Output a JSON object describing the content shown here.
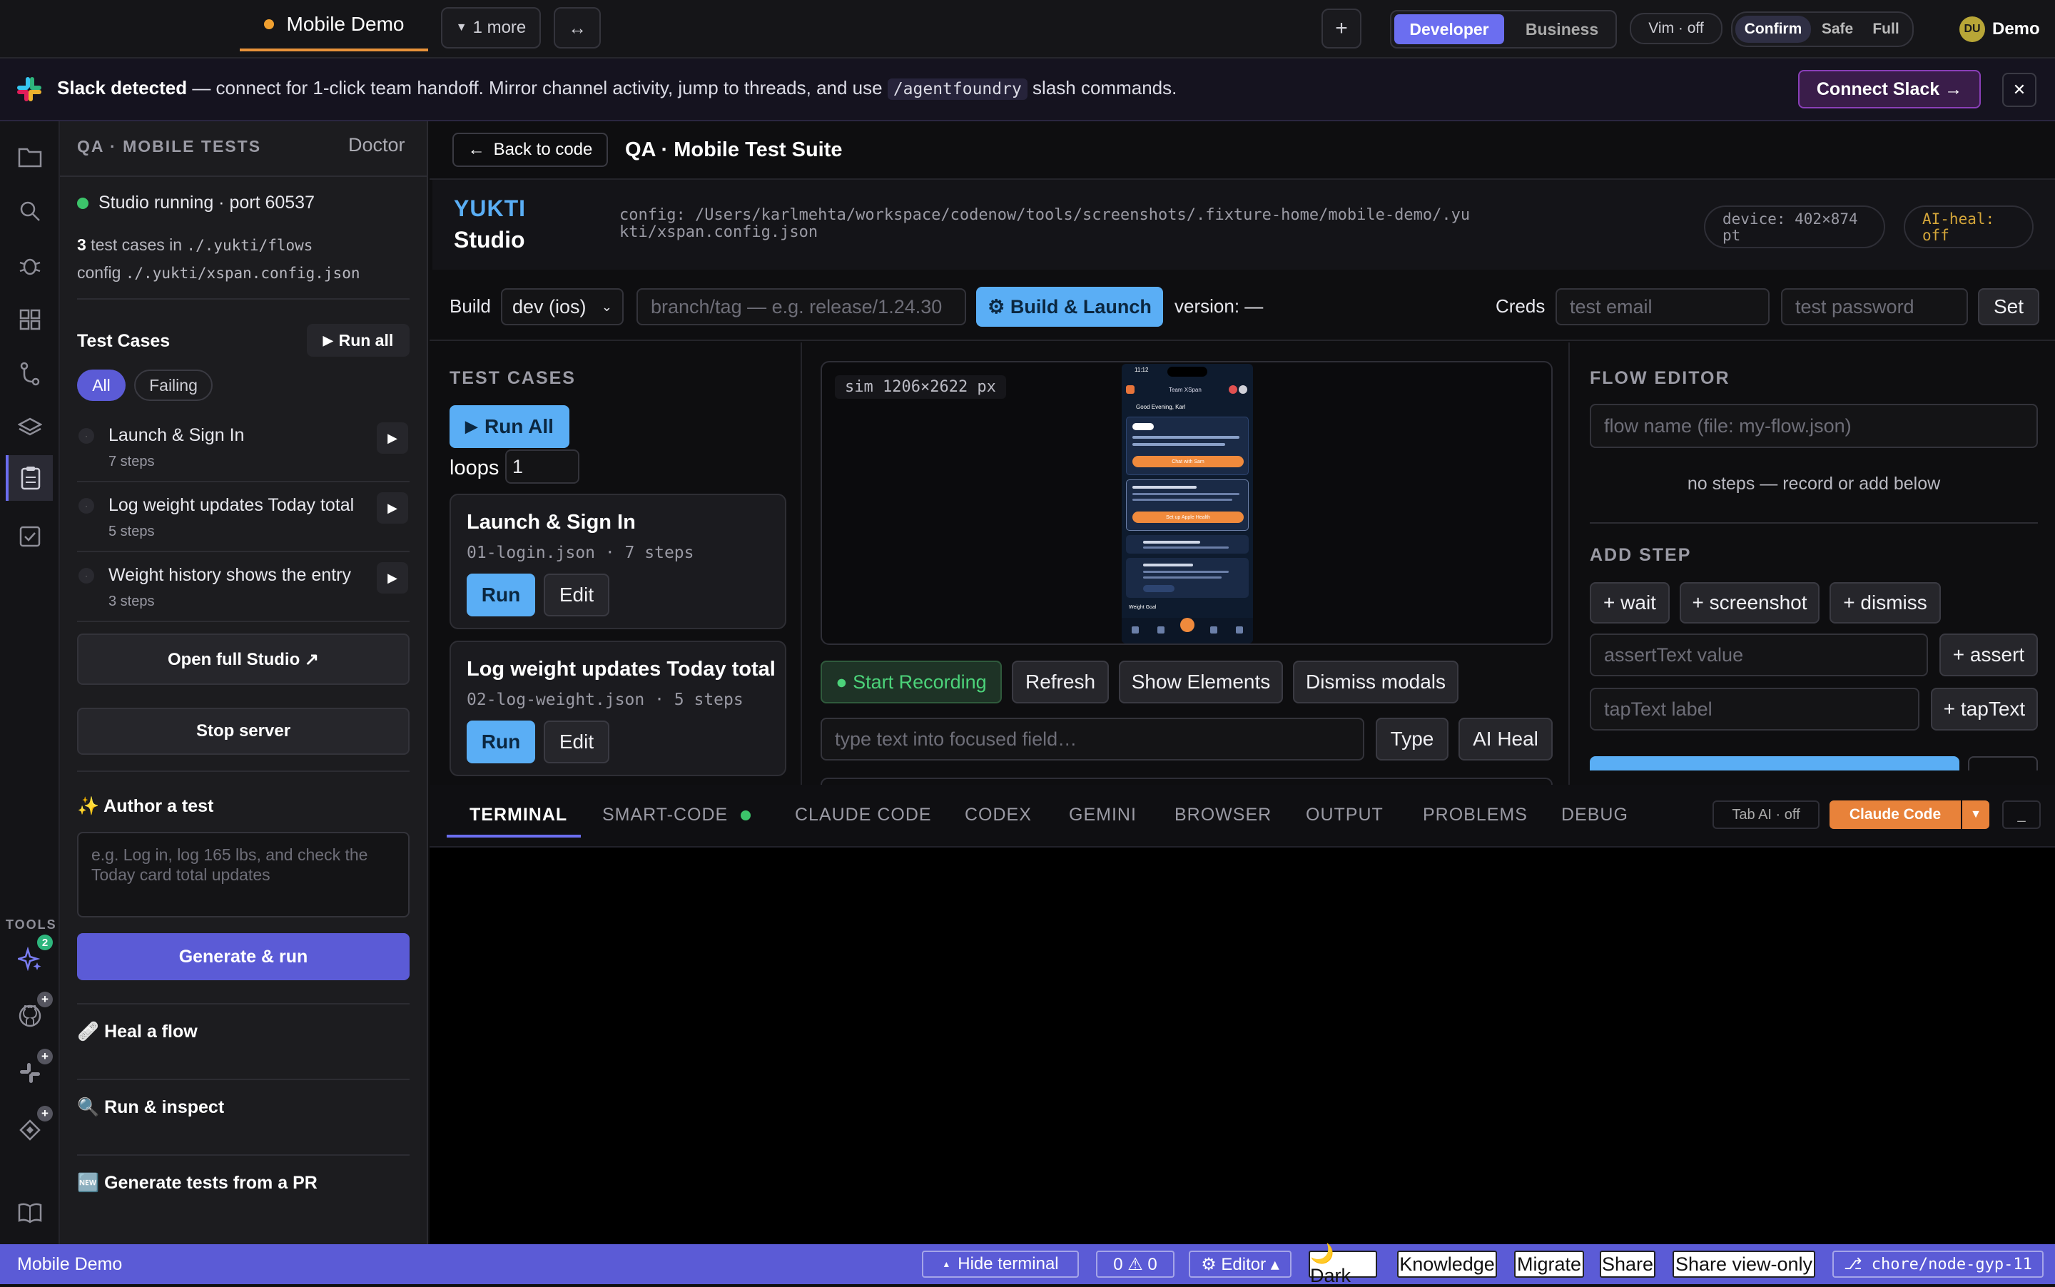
{
  "titlebar": {
    "tab_label": "Mobile Demo",
    "more_label": "1 more",
    "swap_label": "↔",
    "new_tab": "+",
    "mode_developer": "Developer",
    "mode_business": "Business",
    "vim_label": "Vim · off",
    "confirm_label": "Confirm",
    "safe_label": "Safe",
    "full_label": "Full",
    "avatar_initials": "DU",
    "user_name": "Demo"
  },
  "slack": {
    "title": "Slack detected",
    "message_a": " — connect for 1-click team handoff. Mirror channel activity, jump to threads, and use ",
    "command": "/agentfoundry",
    "message_b": " slash commands.",
    "connect_label": "Connect Slack →",
    "close": "✕"
  },
  "rail": {
    "tools_label": "TOOLS",
    "sparkle_badge": "2",
    "plus_badge": "+"
  },
  "left": {
    "header_title": "QA · MOBILE TESTS",
    "doctor_label": "Doctor",
    "server_status": "Studio running · port 60537",
    "test_count": "3",
    "test_count_text": " test cases in ",
    "flows_path": "./.yukti/flows",
    "config_text": "config ",
    "config_path": "./.yukti/xspan.config.json",
    "test_cases_title": "Test Cases",
    "run_all_label": "Run all",
    "filter_all": "All",
    "filter_failing": "Failing",
    "cases": [
      {
        "name": "Launch & Sign In",
        "steps": "7 steps"
      },
      {
        "name": "Log weight updates Today total",
        "steps": "5 steps"
      },
      {
        "name": "Weight history shows the entry",
        "steps": "3 steps"
      }
    ],
    "open_studio_label": "Open full Studio ↗",
    "stop_server_label": "Stop server",
    "author_title": "✨ Author a test",
    "author_placeholder": "e.g. Log in, log 165 lbs, and check the Today card total updates",
    "generate_label": "Generate & run",
    "heal_title": "🩹 Heal a flow",
    "inspect_title": "🔍 Run & inspect",
    "pr_title": "🆕 Generate tests from a PR"
  },
  "main": {
    "back_label": "Back to code",
    "page_title": "QA · Mobile Test Suite",
    "brand_top": "YUKTI",
    "brand_bottom": "Studio",
    "config_line": "config: /Users/karlmehta/workspace/codenow/tools/screenshots/.fixture-home/mobile-demo/.yukti/xspan.config.json",
    "device_label": "device: 402×874 pt",
    "ai_heal_label": "AI-heal: off",
    "build_label": "Build",
    "build_select": "dev (ios)",
    "branch_placeholder": "branch/tag — e.g. release/1.24.30",
    "build_launch_label": "⚙ Build & Launch",
    "version_label": "version: —",
    "creds_label": "Creds",
    "email_placeholder": "test email",
    "password_placeholder": "test password",
    "set_label": "Set",
    "test_cases_header": "TEST CASES",
    "run_all_label": "Run All",
    "loops_label": "loops",
    "loops_value": "1",
    "cards": [
      {
        "title": "Launch & Sign In",
        "meta": "01-login.json · 7 steps",
        "run": "Run",
        "edit": "Edit"
      },
      {
        "title": "Log weight updates Today total",
        "meta": "02-log-weight.json · 5 steps",
        "run": "Run",
        "edit": "Edit"
      }
    ],
    "sim_label": "sim 1206×2622 px",
    "phone": {
      "time": "11:12",
      "team": "Team XSpan",
      "greeting": "Good Evening, Karl",
      "chat_label": "Chat with Sam",
      "health_label": "Set up Apple Health",
      "goal_label": "Weight Goal"
    },
    "start_recording": "● Start Recording",
    "refresh": "Refresh",
    "show_elements": "Show Elements",
    "dismiss_modals": "Dismiss modals",
    "type_placeholder": "type text into focused field…",
    "type_btn": "Type",
    "ai_heal_btn": "AI Heal",
    "flow_editor_header": "FLOW EDITOR",
    "flow_name_placeholder": "flow name (file: my-flow.json)",
    "no_steps": "no steps — record or add below",
    "add_step_header": "ADD STEP",
    "add_wait": "+ wait",
    "add_screenshot": "+ screenshot",
    "add_dismiss": "+ dismiss",
    "assert_placeholder": "assertText value",
    "add_assert": "+ assert",
    "tap_placeholder": "tapText label",
    "add_tap": "+ tapText"
  },
  "terminal": {
    "tabs": [
      "TERMINAL",
      "SMART-CODE",
      "CLAUDE CODE",
      "CODEX",
      "GEMINI",
      "BROWSER",
      "OUTPUT",
      "PROBLEMS",
      "DEBUG"
    ],
    "tab_ai": "Tab AI · off",
    "claude_code": "Claude Code",
    "minimize": "_"
  },
  "status": {
    "workspace": "Mobile Demo",
    "hide_terminal": "Hide terminal",
    "problems": "0 ⚠ 0",
    "editor": "⚙ Editor ▴",
    "dark": "🌙 Dark",
    "knowledge": "Knowledge",
    "migrate": "Migrate",
    "share": "Share",
    "share_view_only": "Share view-only",
    "branch": "⎇ chore/node-gyp-11"
  }
}
